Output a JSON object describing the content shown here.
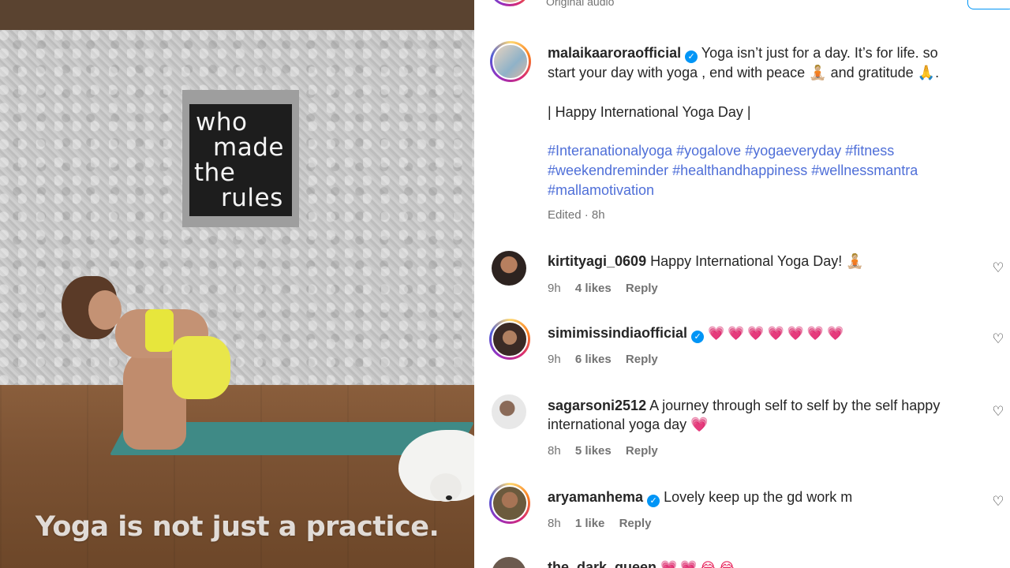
{
  "video": {
    "sign_lines": [
      "who",
      "made",
      "the",
      "rules"
    ],
    "caption": "Yoga is not just a practice."
  },
  "top": {
    "audio_label": "Original audio"
  },
  "post": {
    "username": "malaikaaroraofficial",
    "caption_line1": "Yoga isn’t just for a day. It’s for life. so",
    "caption_line2": "start your day with yoga , end with peace 🧘🏼 and gratitude 🙏.",
    "caption_line3": "| Happy International Yoga Day |",
    "hashtags_line1": "#Interanationalyoga #yogalove #yogaeveryday #fitness",
    "hashtags_line2": "#weekendreminder #healthandhappiness #wellnessmantra",
    "hashtags_line3": "#mallamotivation",
    "meta": "Edited · 8h",
    "verified": true
  },
  "comments": [
    {
      "username": "kirtityagi_0609",
      "verified": false,
      "text": "Happy International Yoga Day! 🧘🏼",
      "time": "9h",
      "likes": "4 likes",
      "reply": "Reply"
    },
    {
      "username": "simimissindiaofficial",
      "verified": true,
      "text": "💗💗💗💗💗💗💗",
      "time": "9h",
      "likes": "6 likes",
      "reply": "Reply"
    },
    {
      "username": "sagarsoni2512",
      "verified": false,
      "text": "A journey through self to self by the self happy international yoga day 💗",
      "time": "8h",
      "likes": "5 likes",
      "reply": "Reply"
    },
    {
      "username": "aryamanhema",
      "verified": true,
      "text": "Lovely keep up the gd work m",
      "time": "8h",
      "likes": "1 like",
      "reply": "Reply"
    },
    {
      "username": "the_dark_queen",
      "verified": false,
      "text": "💗💗😂😂",
      "time": "",
      "likes": "",
      "reply": ""
    }
  ],
  "colors": {
    "hashtag": "#4f6fd8",
    "verified": "#0095f6",
    "muted": "#737373",
    "heart_emoji": "#e8245c"
  },
  "icons": {
    "like": "heart-outline-icon",
    "verified": "verified-badge-icon"
  }
}
